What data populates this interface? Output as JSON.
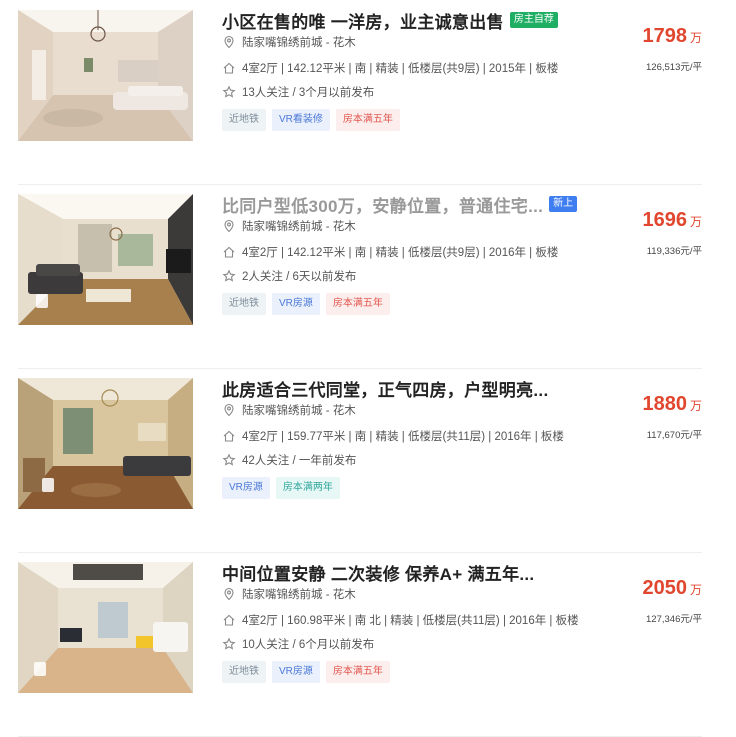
{
  "listings": [
    {
      "title": "小区在售的唯 一洋房，业主诚意出售",
      "badge": "房主自荐",
      "badge_color": "#1eae64",
      "community": "陆家嘴锦绣前城 - 花木",
      "info": "4室2厅 | 142.12平米 | 南 | 精装 | 低楼层(共9层) | 2015年 | 板楼",
      "follow": "13人关注 / 3个月以前发布",
      "tags": [
        "近地铁",
        "VR看装修",
        "房本满五年"
      ],
      "total_price": "1798",
      "price_unit": "万",
      "unit_price": "126,513元/平"
    },
    {
      "title": "比同户型低300万，安静位置，普通住宅...",
      "badge": "新上",
      "badge_color": "#3f7ef0",
      "community": "陆家嘴锦绣前城 - 花木",
      "info": "4室2厅 | 142.12平米 | 南 | 精装 | 低楼层(共9层) | 2016年 | 板楼",
      "follow": "2人关注 / 6天以前发布",
      "tags": [
        "近地铁",
        "VR房源",
        "房本满五年"
      ],
      "total_price": "1696",
      "price_unit": "万",
      "unit_price": "119,336元/平"
    },
    {
      "title": "此房适合三代同堂，正气四房，户型明亮...",
      "badge": "",
      "badge_color": "",
      "community": "陆家嘴锦绣前城 - 花木",
      "info": "4室2厅 | 159.77平米 | 南 | 精装 | 低楼层(共11层) | 2016年 | 板楼",
      "follow": "42人关注 / 一年前发布",
      "tags": [
        "VR房源",
        "房本满两年"
      ],
      "total_price": "1880",
      "price_unit": "万",
      "unit_price": "117,670元/平"
    },
    {
      "title": "中间位置安静 二次装修 保养A+ 满五年...",
      "badge": "",
      "badge_color": "",
      "community": "陆家嘴锦绣前城 - 花木",
      "info": "4室2厅 | 160.98平米 | 南 北 | 精装 | 低楼层(共11层) | 2016年 | 板楼",
      "follow": "10人关注 / 6个月以前发布",
      "tags": [
        "近地铁",
        "VR房源",
        "房本满五年"
      ],
      "total_price": "2050",
      "price_unit": "万",
      "unit_price": "127,346元/平"
    }
  ],
  "icons": {
    "location": "location-pin-icon",
    "house": "house-icon",
    "follow": "star-icon",
    "vr": "vr-badge-icon"
  },
  "colors": {
    "price": "#e1462f",
    "title": "#222222"
  }
}
